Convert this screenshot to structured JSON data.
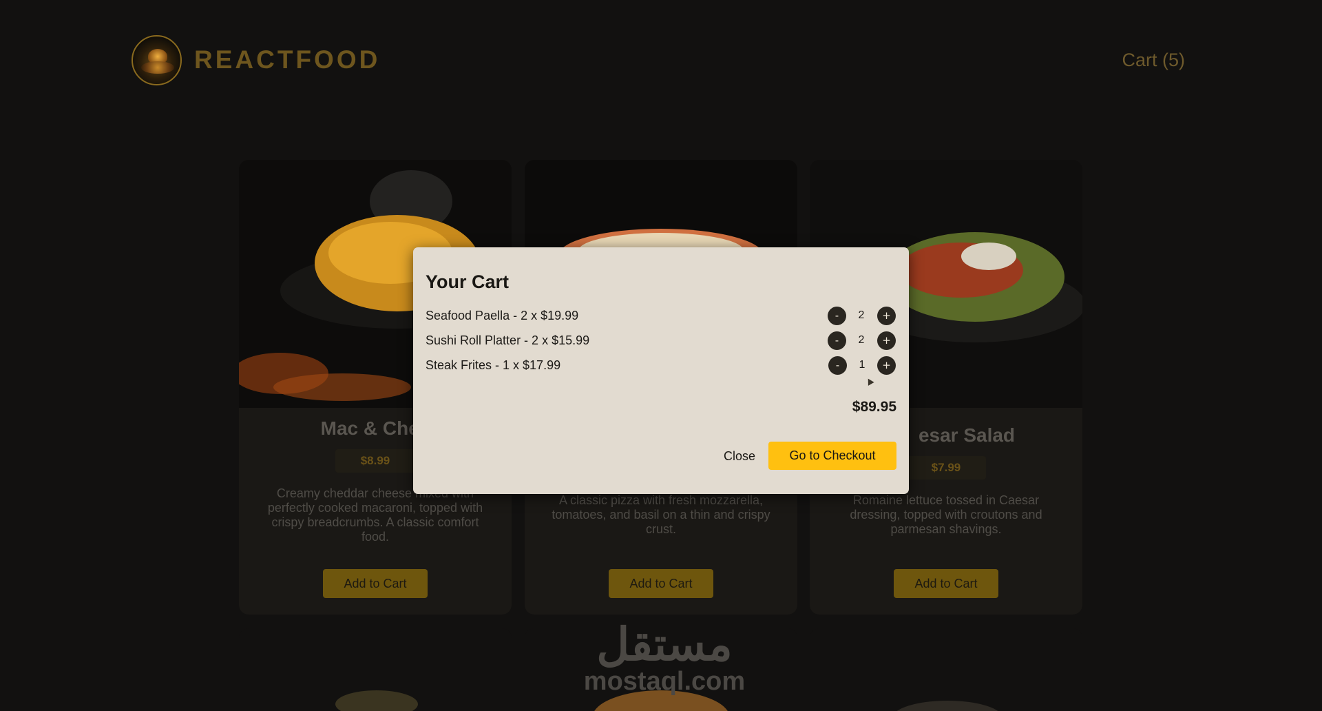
{
  "header": {
    "brand": "REACTFOOD",
    "cart_label": "Cart (5)"
  },
  "menu": {
    "items": [
      {
        "title": "Mac & Chee",
        "price": "$8.99",
        "description": "Creamy cheddar cheese mixed with perfectly cooked macaroni, topped with crispy breadcrumbs. A classic comfort food.",
        "button": "Add to Cart"
      },
      {
        "title": "",
        "price": "",
        "description": "A classic pizza with fresh mozzarella, tomatoes, and basil on a thin and crispy crust.",
        "button": "Add to Cart"
      },
      {
        "title": "esar Salad",
        "price": "$7.99",
        "description": "Romaine lettuce tossed in Caesar dressing, topped with croutons and parmesan shavings.",
        "button": "Add to Cart"
      }
    ]
  },
  "watermark": {
    "arabic": "مستقل",
    "latin": "mostaql.com"
  },
  "modal": {
    "title": "Your Cart",
    "items": [
      {
        "label": "Seafood Paella - 2 x $19.99",
        "qty": "2"
      },
      {
        "label": "Sushi Roll Platter - 2 x $15.99",
        "qty": "2"
      },
      {
        "label": "Steak Frites - 1 x $17.99",
        "qty": "1"
      }
    ],
    "minus_label": "-",
    "plus_label": "+",
    "total": "$89.95",
    "close_label": "Close",
    "checkout_label": "Go to Checkout"
  },
  "colors": {
    "accent": "#ffc010",
    "modal_bg": "#e2dbd0",
    "page_bg": "#121110"
  }
}
